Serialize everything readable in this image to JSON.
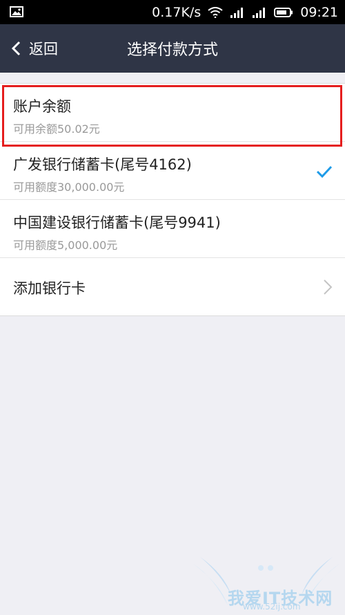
{
  "status_bar": {
    "net_speed": "0.17K/s",
    "time": "09:21",
    "icons": [
      "image-notification-icon",
      "wifi-icon",
      "signal-icon",
      "signal-icon",
      "battery-icon"
    ]
  },
  "nav": {
    "back_label": "返回",
    "title": "选择付款方式"
  },
  "payment_methods": [
    {
      "title": "账户余额",
      "subtitle": "可用余额50.02元",
      "selected": false,
      "highlighted": true
    },
    {
      "title": "广发银行储蓄卡(尾号4162)",
      "subtitle": "可用额度30,000.00元",
      "selected": true
    },
    {
      "title": "中国建设银行储蓄卡(尾号9941)",
      "subtitle": "可用额度5,000.00元",
      "selected": false
    }
  ],
  "add_card": {
    "label": "添加银行卡"
  },
  "colors": {
    "nav_bg": "#2f3546",
    "check": "#1e9be8",
    "highlight": "#e51d1d",
    "page_bg": "#efeff4"
  },
  "watermark": {
    "text": "我爱IT技术网",
    "url": "www.52ij.com"
  }
}
